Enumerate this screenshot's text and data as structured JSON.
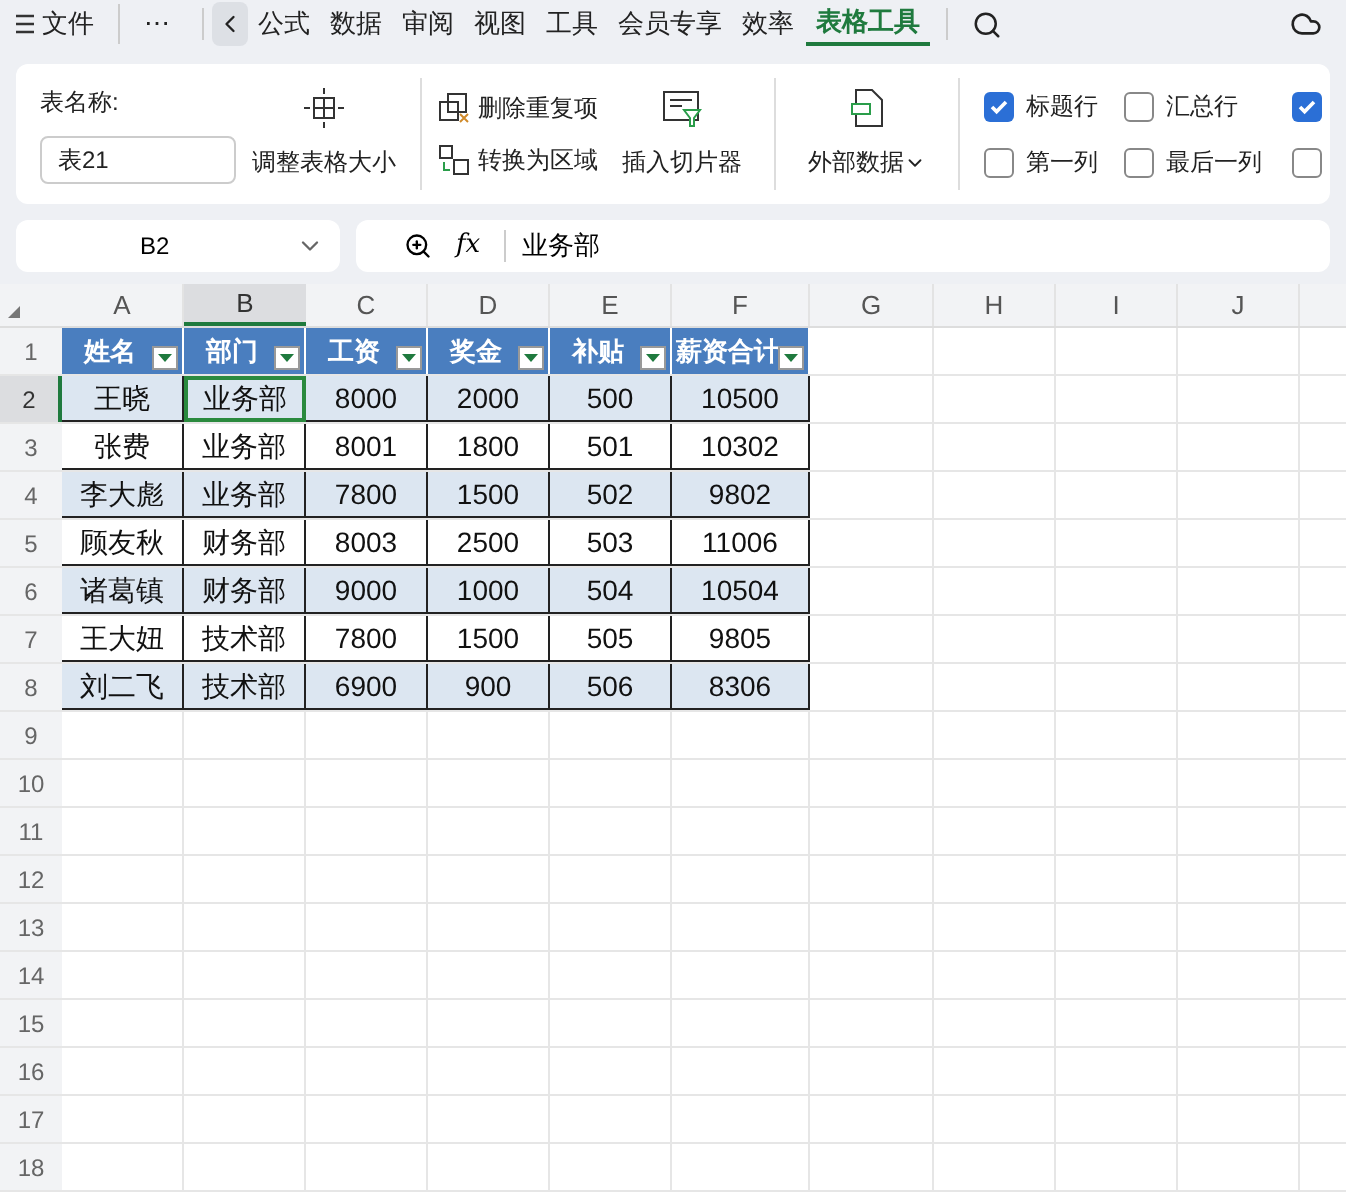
{
  "menu": {
    "file": "文件",
    "more": "⋯"
  },
  "tabs": [
    {
      "label": "公式",
      "selected": false
    },
    {
      "label": "数据",
      "selected": false
    },
    {
      "label": "审阅",
      "selected": false
    },
    {
      "label": "视图",
      "selected": false
    },
    {
      "label": "工具",
      "selected": false
    },
    {
      "label": "会员专享",
      "selected": false
    },
    {
      "label": "效率",
      "selected": false
    },
    {
      "label": "表格工具",
      "selected": true
    }
  ],
  "ribbon": {
    "table_name_label": "表名称:",
    "table_name_value": "表21",
    "resize": "调整表格大小",
    "remove_duplicates": "删除重复项",
    "convert_to_range": "转换为区域",
    "insert_slicer": "插入切片器",
    "external_data": "外部数据",
    "options": [
      {
        "label": "标题行",
        "checked": true
      },
      {
        "label": "第一列",
        "checked": false
      },
      {
        "label": "汇总行",
        "checked": false
      },
      {
        "label": "最后一列",
        "checked": false
      },
      {
        "checked": true
      },
      {
        "checked": false
      }
    ]
  },
  "formula_bar": {
    "name_box": "B2",
    "fx": "fx",
    "value": "业务部"
  },
  "sheet": {
    "columns": [
      {
        "label": "A",
        "selected": false
      },
      {
        "label": "B",
        "selected": true
      },
      {
        "label": "C",
        "selected": false
      },
      {
        "label": "D",
        "selected": false
      },
      {
        "label": "E",
        "selected": false
      },
      {
        "label": "F",
        "selected": false
      },
      {
        "label": "G",
        "selected": false
      },
      {
        "label": "H",
        "selected": false
      },
      {
        "label": "I",
        "selected": false
      },
      {
        "label": "J",
        "selected": false
      }
    ],
    "header_row": [
      "姓名",
      "部门",
      "工资",
      "奖金",
      "补贴",
      "薪资合计"
    ],
    "rows": [
      {
        "number": "1",
        "selected": false
      },
      {
        "number": "2",
        "selected": true,
        "cells": [
          "王晓",
          "业务部",
          "8000",
          "2000",
          "500",
          "10500"
        ]
      },
      {
        "number": "3",
        "selected": false,
        "cells": [
          "张费",
          "业务部",
          "8001",
          "1800",
          "501",
          "10302"
        ]
      },
      {
        "number": "4",
        "selected": false,
        "cells": [
          "李大彪",
          "业务部",
          "7800",
          "1500",
          "502",
          "9802"
        ]
      },
      {
        "number": "5",
        "selected": false,
        "cells": [
          "顾友秋",
          "财务部",
          "8003",
          "2500",
          "503",
          "11006"
        ]
      },
      {
        "number": "6",
        "selected": false,
        "cells": [
          "诸葛镇",
          "财务部",
          "9000",
          "1000",
          "504",
          "10504"
        ]
      },
      {
        "number": "7",
        "selected": false,
        "cells": [
          "王大妞",
          "技术部",
          "7800",
          "1500",
          "505",
          "9805"
        ]
      },
      {
        "number": "8",
        "selected": false,
        "cells": [
          "刘二飞",
          "技术部",
          "6900",
          "900",
          "506",
          "8306"
        ]
      },
      {
        "number": "9",
        "selected": false
      },
      {
        "number": "10",
        "selected": false
      },
      {
        "number": "11",
        "selected": false
      },
      {
        "number": "12",
        "selected": false
      },
      {
        "number": "13",
        "selected": false
      },
      {
        "number": "14",
        "selected": false
      },
      {
        "number": "15",
        "selected": false
      },
      {
        "number": "16",
        "selected": false
      },
      {
        "number": "17",
        "selected": false
      },
      {
        "number": "18",
        "selected": false
      }
    ]
  }
}
